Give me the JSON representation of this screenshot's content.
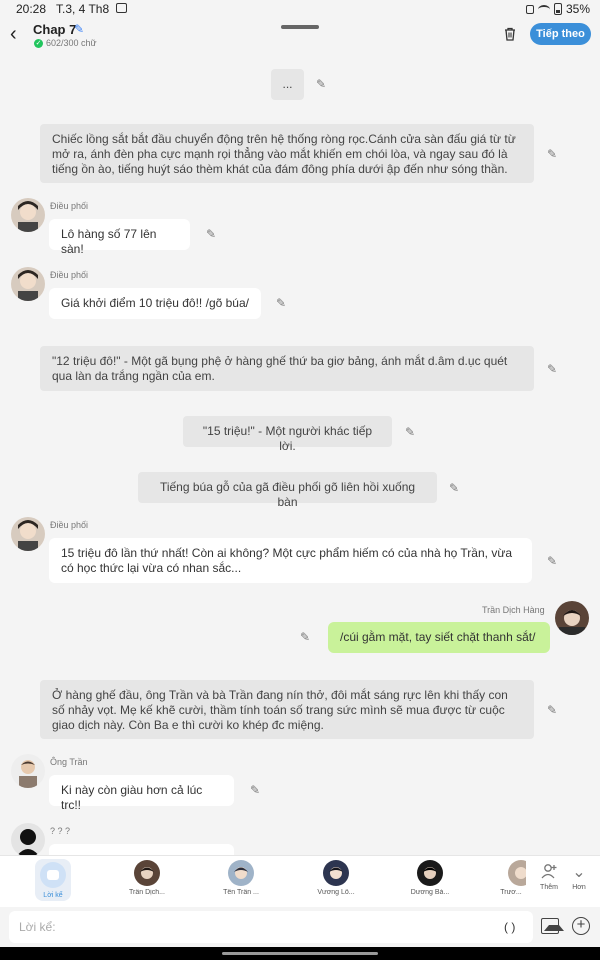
{
  "status": {
    "time": "20:28",
    "date": "T.3, 4 Th8",
    "battery": "35%"
  },
  "header": {
    "back_icon": "chevron-left-icon",
    "title": "Chap 7",
    "word_count": "602/300 chữ",
    "next_label": "Tiếp theo"
  },
  "messages": [
    {
      "type": "narration",
      "text": "..."
    },
    {
      "type": "narration",
      "text": "Chiếc lồng sắt bắt đầu chuyển động trên hệ thống ròng rọc.Cánh cửa sàn đấu giá từ từ mở ra, ánh đèn pha cực mạnh rọi thẳng vào mắt khiến em chói lòa, và ngay sau đó là tiếng ồn ào, tiếng huýt sáo thèm khát của đám đông phía dưới ập đến như sóng thần."
    },
    {
      "type": "character",
      "sender": "Điều phối",
      "text": "Lô hàng số 77 lên sàn!"
    },
    {
      "type": "character",
      "sender": "Điều phối",
      "text": "Giá khởi điểm 10 triệu đô!! /gõ búa/"
    },
    {
      "type": "narration",
      "text": "\"12 triệu đô!\" - Một gã bụng phệ ở hàng ghế thứ ba giơ bảng, ánh mắt d.âm d.ục quét qua làn da trắng ngần của em."
    },
    {
      "type": "narration",
      "text": "\"15 triệu!\" - Một người khác tiếp lời."
    },
    {
      "type": "narration",
      "text": "Tiếng búa gỗ của gã điều phối gõ liên hồi xuống bàn"
    },
    {
      "type": "character",
      "sender": "Điều phối",
      "text": "15 triệu đô lần thứ nhất! Còn ai không? Một cực phẩm hiếm có của nhà họ Trần, vừa có học thức lại vừa có nhan sắc..."
    },
    {
      "type": "me",
      "sender": "Trần Dịch Hàng",
      "text": "/cúi gằm mặt, tay siết chặt thanh sắt/"
    },
    {
      "type": "narration",
      "text": "Ở hàng ghế đầu, ông Trần và bà Trần đang nín thở, đôi mắt sáng rực lên khi thấy con số nhảy vọt. Mẹ kế khẽ cười, thầm tính toán số trang sức mình sẽ mua được từ cuộc giao dịch này. Còn Ba e thì cười ko khép đc miệng."
    },
    {
      "type": "character",
      "sender": "Ông Trần",
      "text": "Ki này còn giàu hơn cả lúc trc!!"
    },
    {
      "type": "character",
      "sender": "? ? ?",
      "text": ""
    }
  ],
  "characters": [
    {
      "name": "Lời kể",
      "selected": true
    },
    {
      "name": "Trần Dịch..."
    },
    {
      "name": "Tên Trần ..."
    },
    {
      "name": "Vương Lô..."
    },
    {
      "name": "Dương Bá..."
    },
    {
      "name": "Trươ..."
    }
  ],
  "strip_actions": {
    "add_label": "Thêm",
    "more_label": "Hơn"
  },
  "composer": {
    "placeholder": "Lời kể:",
    "paren": "( )"
  },
  "colors": {
    "accent": "#3b8fd9",
    "narration_bg": "#e6e6e6",
    "bubble_bg": "#ffffff",
    "my_bubble_bg": "#c9f29a"
  }
}
